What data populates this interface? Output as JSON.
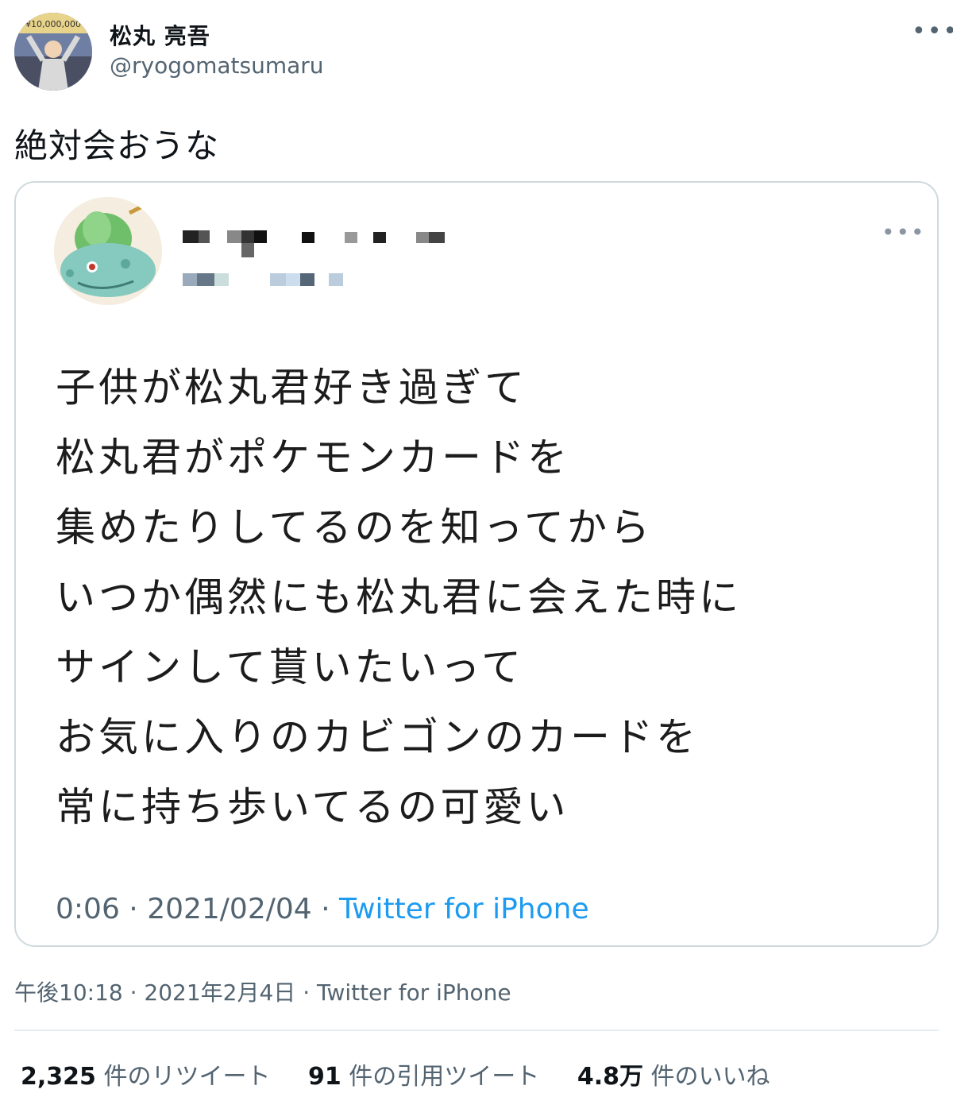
{
  "author": {
    "name": "松丸 亮吾",
    "handle": "@ryogomatsumaru",
    "avatar_icon": "person-photo-avatar",
    "more_icon": "more-horizontal-icon"
  },
  "tweet": {
    "text": "絶対会おうな",
    "timestamp": "午後10:18 · 2021年2月4日",
    "source": "Twitter for iPhone"
  },
  "quoted_tweet": {
    "avatar_icon": "bulbasaur-avatar",
    "name_pixelated": true,
    "handle_pixelated": true,
    "lines": [
      "子供が松丸君好き過ぎて",
      "松丸君がポケモンカードを",
      "集めたりしてるのを知ってから",
      "いつか偶然にも松丸君に会えた時に",
      "サインして貰いたいって",
      "お気に入りのカビゴンのカードを",
      "常に持ち歩いてるの可愛い"
    ],
    "time": "0:06",
    "date": "2021/02/04",
    "source": "Twitter for iPhone"
  },
  "stats": [
    {
      "count": "2,325",
      "label": "件のリツイート"
    },
    {
      "count": "91",
      "label": "件の引用ツイート"
    },
    {
      "count": "4.8万",
      "label": "件のいいね"
    }
  ],
  "colors": {
    "link": "#1d9bf0",
    "secondary_text": "#536471",
    "border": "#cfd9de"
  }
}
